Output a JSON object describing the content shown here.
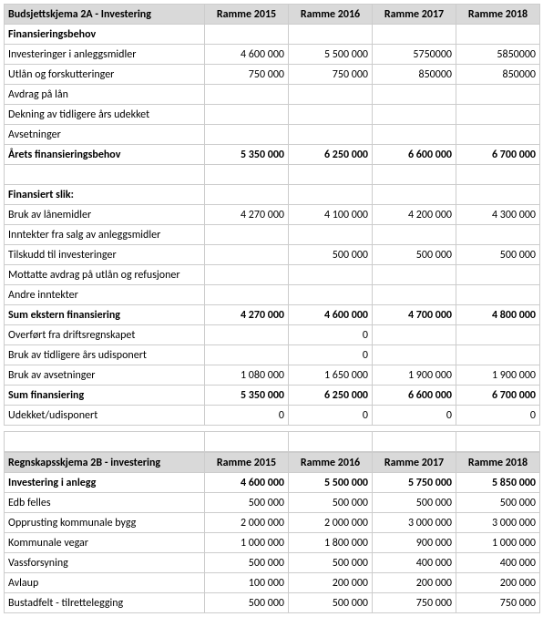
{
  "tableA": {
    "title": "Budsjettskjema 2A - Investering",
    "cols": [
      "Ramme 2015",
      "Ramme 2016",
      "Ramme 2017",
      "Ramme 2018"
    ],
    "rows": [
      {
        "label": "Finansieringsbehov",
        "v": [
          "",
          "",
          "",
          ""
        ],
        "bold": true
      },
      {
        "label": "Investeringer i anleggsmidler",
        "v": [
          "4 600 000",
          "5 500 000",
          "5750000",
          "5850000"
        ]
      },
      {
        "label": "Utlån og forskutteringer",
        "v": [
          "750 000",
          "750 000",
          "850000",
          "850000"
        ]
      },
      {
        "label": "Avdrag på lån",
        "v": [
          "",
          "",
          "",
          ""
        ]
      },
      {
        "label": "Dekning av tidligere års udekket",
        "v": [
          "",
          "",
          "",
          ""
        ]
      },
      {
        "label": "Avsetninger",
        "v": [
          "",
          "",
          "",
          ""
        ]
      },
      {
        "label": "Årets finansieringsbehov",
        "v": [
          "5 350 000",
          "6 250 000",
          "6 600 000",
          "6 700 000"
        ],
        "bold": true
      },
      {
        "label": "",
        "v": [
          "",
          "",
          "",
          ""
        ],
        "spacer": true
      },
      {
        "label": "Finansiert slik:",
        "v": [
          "",
          "",
          "",
          ""
        ],
        "bold": true
      },
      {
        "label": "Bruk av lånemidler",
        "v": [
          "4 270 000",
          "4 100 000",
          "4 200 000",
          "4 300 000"
        ]
      },
      {
        "label": "Inntekter fra salg av anleggsmidler",
        "v": [
          "",
          "",
          "",
          ""
        ]
      },
      {
        "label": "Tilskudd til investeringer",
        "v": [
          "",
          "500 000",
          "500 000",
          "500 000"
        ]
      },
      {
        "label": "Mottatte avdrag på utlån og refusjoner",
        "v": [
          "",
          "",
          "",
          ""
        ]
      },
      {
        "label": "Andre inntekter",
        "v": [
          "",
          "",
          "",
          ""
        ]
      },
      {
        "label": "Sum ekstern finansiering",
        "v": [
          "4 270 000",
          "4 600 000",
          "4 700 000",
          "4 800 000"
        ],
        "bold": true
      },
      {
        "label": "Overført fra driftsregnskapet",
        "v": [
          "",
          "0",
          "",
          ""
        ]
      },
      {
        "label": "Bruk av tidligere års udisponert",
        "v": [
          "",
          "0",
          "",
          ""
        ]
      },
      {
        "label": "Bruk av avsetninger",
        "v": [
          "1 080 000",
          "1 650 000",
          "1 900 000",
          "1 900 000"
        ]
      },
      {
        "label": "Sum finansiering",
        "v": [
          "5 350 000",
          "6 250 000",
          "6 600 000",
          "6 700 000"
        ],
        "bold": true
      },
      {
        "label": "Udekket/udisponert",
        "v": [
          "0",
          "0",
          "0",
          "0"
        ]
      }
    ]
  },
  "tableB": {
    "title": "Regnskapsskjema 2B - investering",
    "cols": [
      "Ramme 2015",
      "Ramme 2016",
      "Ramme 2017",
      "Ramme 2018"
    ],
    "rows": [
      {
        "label": "Investering i anlegg",
        "v": [
          "4 600 000",
          "5 500 000",
          "5 750 000",
          "5 850 000"
        ],
        "bold": true
      },
      {
        "label": "Edb felles",
        "v": [
          "500 000",
          "500 000",
          "500 000",
          "500 000"
        ]
      },
      {
        "label": "Opprusting kommunale bygg",
        "v": [
          "2 000 000",
          "2 000 000",
          "3 000 000",
          "3 000 000"
        ]
      },
      {
        "label": "Kommunale vegar",
        "v": [
          "1 000 000",
          "1 800 000",
          "900 000",
          "1 000 000"
        ]
      },
      {
        "label": "Vassforsyning",
        "v": [
          "500 000",
          "500 000",
          "400 000",
          "400 000"
        ]
      },
      {
        "label": "Avlaup",
        "v": [
          "100 000",
          "200 000",
          "200 000",
          "200 000"
        ]
      },
      {
        "label": "Bustadfelt - tilrettelegging",
        "v": [
          "500 000",
          "500 000",
          "750 000",
          "750 000"
        ]
      }
    ]
  }
}
